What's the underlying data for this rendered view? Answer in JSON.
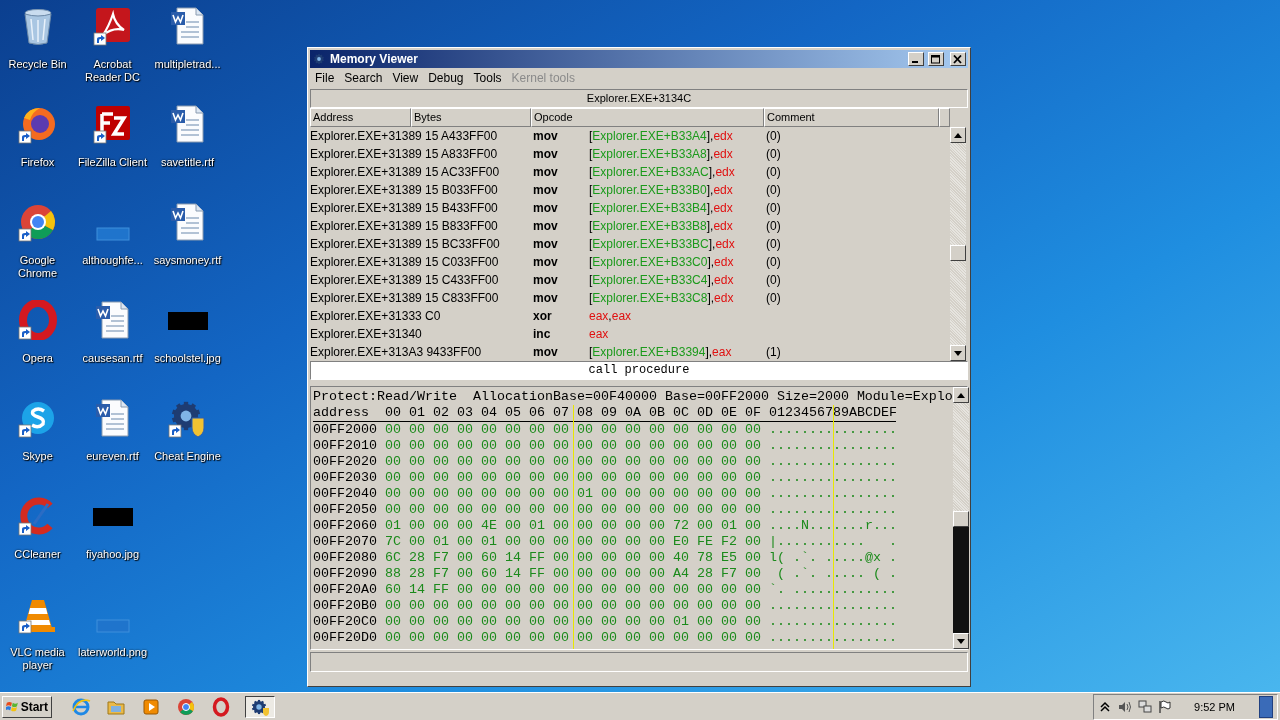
{
  "desktop_icons": [
    {
      "label": "Recycle Bin",
      "kind": "recycle",
      "shortcut": false
    },
    {
      "label": "Firefox",
      "kind": "firefox",
      "shortcut": true
    },
    {
      "label": "Google Chrome",
      "kind": "chrome",
      "shortcut": true
    },
    {
      "label": "Opera",
      "kind": "opera",
      "shortcut": true
    },
    {
      "label": "Skype",
      "kind": "skype",
      "shortcut": true
    },
    {
      "label": "CCleaner",
      "kind": "ccleaner",
      "shortcut": true
    },
    {
      "label": "VLC media player",
      "kind": "vlc",
      "shortcut": true
    },
    {
      "label": "Acrobat Reader DC",
      "kind": "acrobat",
      "shortcut": true
    },
    {
      "label": "FileZilla Client",
      "kind": "filezilla",
      "shortcut": true
    },
    {
      "label": "althoughfe...",
      "kind": "blank",
      "shortcut": false
    },
    {
      "label": "causesan.rtf",
      "kind": "word",
      "shortcut": false
    },
    {
      "label": "eureven.rtf",
      "kind": "word",
      "shortcut": false
    },
    {
      "label": "fiyahoo.jpg",
      "kind": "black-thumb",
      "shortcut": false
    },
    {
      "label": "laterworld.png",
      "kind": "blank",
      "shortcut": false
    },
    {
      "label": "multipletrad...",
      "kind": "word",
      "shortcut": false
    },
    {
      "label": "savetitle.rtf",
      "kind": "word",
      "shortcut": false
    },
    {
      "label": "saysmoney.rtf",
      "kind": "word",
      "shortcut": false
    },
    {
      "label": "schoolstel.jpg",
      "kind": "black-thumb",
      "shortcut": false
    },
    {
      "label": "Cheat Engine",
      "kind": "cheat-engine",
      "shortcut": true
    }
  ],
  "window": {
    "title": "Memory Viewer",
    "menu": [
      {
        "label": "File",
        "disabled": false
      },
      {
        "label": "Search",
        "disabled": false
      },
      {
        "label": "View",
        "disabled": false
      },
      {
        "label": "Debug",
        "disabled": false
      },
      {
        "label": "Tools",
        "disabled": false
      },
      {
        "label": "Kernel tools",
        "disabled": true
      }
    ],
    "disassembler": {
      "address_bar": "Explorer.EXE+3134C",
      "columns": [
        "Address",
        "Bytes",
        "Opcode",
        "Comment"
      ],
      "rows": [
        {
          "address_bytes": "Explorer.EXE+31389 15 A433FF00",
          "opcode": "mov",
          "operand": [
            {
              "kind": "punct",
              "text": "["
            },
            {
              "kind": "mem",
              "text": "Explorer.EXE+B33A4"
            },
            {
              "kind": "punct",
              "text": "],"
            },
            {
              "kind": "reg",
              "text": "edx"
            }
          ],
          "comment": "(0)"
        },
        {
          "address_bytes": "Explorer.EXE+31389 15 A833FF00",
          "opcode": "mov",
          "operand": [
            {
              "kind": "punct",
              "text": "["
            },
            {
              "kind": "mem",
              "text": "Explorer.EXE+B33A8"
            },
            {
              "kind": "punct",
              "text": "],"
            },
            {
              "kind": "reg",
              "text": "edx"
            }
          ],
          "comment": "(0)"
        },
        {
          "address_bytes": "Explorer.EXE+31389 15 AC33FF00",
          "opcode": "mov",
          "operand": [
            {
              "kind": "punct",
              "text": "["
            },
            {
              "kind": "mem",
              "text": "Explorer.EXE+B33AC"
            },
            {
              "kind": "punct",
              "text": "],"
            },
            {
              "kind": "reg",
              "text": "edx"
            }
          ],
          "comment": "(0)"
        },
        {
          "address_bytes": "Explorer.EXE+31389 15 B033FF00",
          "opcode": "mov",
          "operand": [
            {
              "kind": "punct",
              "text": "["
            },
            {
              "kind": "mem",
              "text": "Explorer.EXE+B33B0"
            },
            {
              "kind": "punct",
              "text": "],"
            },
            {
              "kind": "reg",
              "text": "edx"
            }
          ],
          "comment": "(0)"
        },
        {
          "address_bytes": "Explorer.EXE+31389 15 B433FF00",
          "opcode": "mov",
          "operand": [
            {
              "kind": "punct",
              "text": "["
            },
            {
              "kind": "mem",
              "text": "Explorer.EXE+B33B4"
            },
            {
              "kind": "punct",
              "text": "],"
            },
            {
              "kind": "reg",
              "text": "edx"
            }
          ],
          "comment": "(0)"
        },
        {
          "address_bytes": "Explorer.EXE+31389 15 B833FF00",
          "opcode": "mov",
          "operand": [
            {
              "kind": "punct",
              "text": "["
            },
            {
              "kind": "mem",
              "text": "Explorer.EXE+B33B8"
            },
            {
              "kind": "punct",
              "text": "],"
            },
            {
              "kind": "reg",
              "text": "edx"
            }
          ],
          "comment": "(0)"
        },
        {
          "address_bytes": "Explorer.EXE+31389 15 BC33FF00",
          "opcode": "mov",
          "operand": [
            {
              "kind": "punct",
              "text": "["
            },
            {
              "kind": "mem",
              "text": "Explorer.EXE+B33BC"
            },
            {
              "kind": "punct",
              "text": "],"
            },
            {
              "kind": "reg",
              "text": "edx"
            }
          ],
          "comment": "(0)"
        },
        {
          "address_bytes": "Explorer.EXE+31389 15 C033FF00",
          "opcode": "mov",
          "operand": [
            {
              "kind": "punct",
              "text": "["
            },
            {
              "kind": "mem",
              "text": "Explorer.EXE+B33C0"
            },
            {
              "kind": "punct",
              "text": "],"
            },
            {
              "kind": "reg",
              "text": "edx"
            }
          ],
          "comment": "(0)"
        },
        {
          "address_bytes": "Explorer.EXE+31389 15 C433FF00",
          "opcode": "mov",
          "operand": [
            {
              "kind": "punct",
              "text": "["
            },
            {
              "kind": "mem",
              "text": "Explorer.EXE+B33C4"
            },
            {
              "kind": "punct",
              "text": "],"
            },
            {
              "kind": "reg",
              "text": "edx"
            }
          ],
          "comment": "(0)"
        },
        {
          "address_bytes": "Explorer.EXE+31389 15 C833FF00",
          "opcode": "mov",
          "operand": [
            {
              "kind": "punct",
              "text": "["
            },
            {
              "kind": "mem",
              "text": "Explorer.EXE+B33C8"
            },
            {
              "kind": "punct",
              "text": "],"
            },
            {
              "kind": "reg",
              "text": "edx"
            }
          ],
          "comment": "(0)"
        },
        {
          "address_bytes": "Explorer.EXE+31333 C0",
          "opcode": "xor",
          "operand": [
            {
              "kind": "reg",
              "text": "eax"
            },
            {
              "kind": "punct",
              "text": ","
            },
            {
              "kind": "reg",
              "text": "eax"
            }
          ]
        },
        {
          "address_bytes": "Explorer.EXE+31340",
          "opcode": "inc",
          "operand": [
            {
              "kind": "reg",
              "text": "eax"
            }
          ]
        },
        {
          "address_bytes": "Explorer.EXE+313A3 9433FF00",
          "opcode": "mov",
          "operand": [
            {
              "kind": "punct",
              "text": "["
            },
            {
              "kind": "mem",
              "text": "Explorer.EXE+B3394"
            },
            {
              "kind": "punct",
              "text": "],"
            },
            {
              "kind": "reg",
              "text": "eax"
            }
          ],
          "comment": "(1)"
        }
      ],
      "status": "call procedure"
    },
    "hex_view": {
      "info": "Protect:Read/Write  AllocationBase=00F40000 Base=00FF2000 Size=2000 Module=Explo",
      "header": {
        "address": "address",
        "bytes": "00 01 02 03 04 05 06 07 08 09 0A 0B 0C 0D 0E 0F",
        "ascii": "0123456789ABCDEF"
      },
      "rows": [
        {
          "address": "00FF2000",
          "bytes": "00 00 00 00 00 00 00 00 00 00 00 00 00 00 00 00",
          "ascii": "................"
        },
        {
          "address": "00FF2010",
          "bytes": "00 00 00 00 00 00 00 00 00 00 00 00 00 00 00 00",
          "ascii": "................"
        },
        {
          "address": "00FF2020",
          "bytes": "00 00 00 00 00 00 00 00 00 00 00 00 00 00 00 00",
          "ascii": "................"
        },
        {
          "address": "00FF2030",
          "bytes": "00 00 00 00 00 00 00 00 00 00 00 00 00 00 00 00",
          "ascii": "................"
        },
        {
          "address": "00FF2040",
          "bytes": "00 00 00 00 00 00 00 00 01 00 00 00 00 00 00 00",
          "ascii": "................"
        },
        {
          "address": "00FF2050",
          "bytes": "00 00 00 00 00 00 00 00 00 00 00 00 00 00 00 00",
          "ascii": "................"
        },
        {
          "address": "00FF2060",
          "bytes": "01 00 00 00 4E 00 01 00 00 00 00 00 72 00 01 00",
          "ascii": "....N.......r..."
        },
        {
          "address": "00FF2070",
          "bytes": "7C 00 01 00 01 00 00 00 00 00 00 00 E0 FE F2 00",
          "ascii": "|...........   ."
        },
        {
          "address": "00FF2080",
          "bytes": "6C 28 F7 00 60 14 FF 00 00 00 00 00 40 78 E5 00",
          "ascii": "l( .`. .....@x ."
        },
        {
          "address": "00FF2090",
          "bytes": "88 28 F7 00 60 14 FF 00 00 00 00 00 A4 28 F7 00",
          "ascii": " ( .`. ..... ( ."
        },
        {
          "address": "00FF20A0",
          "bytes": "60 14 FF 00 00 00 00 00 00 00 00 00 00 00 00 00",
          "ascii": "`. ............."
        },
        {
          "address": "00FF20B0",
          "bytes": "00 00 00 00 00 00 00 00 00 00 00 00 00 00 00 00",
          "ascii": "................"
        },
        {
          "address": "00FF20C0",
          "bytes": "00 00 00 00 00 00 00 00 00 00 00 00 01 00 00 00",
          "ascii": "................"
        },
        {
          "address": "00FF20D0",
          "bytes": "00 00 00 00 00 00 00 00 00 00 00 00 00 00 00 00",
          "ascii": "................"
        }
      ]
    }
  },
  "taskbar": {
    "start": "Start",
    "apps": [
      {
        "kind": "ie",
        "active": false
      },
      {
        "kind": "folder",
        "active": false
      },
      {
        "kind": "media",
        "active": false
      },
      {
        "kind": "chrome",
        "active": false
      },
      {
        "kind": "opera",
        "active": false
      },
      {
        "kind": "cheat-engine",
        "active": true
      }
    ],
    "clock": "9:52 PM"
  }
}
